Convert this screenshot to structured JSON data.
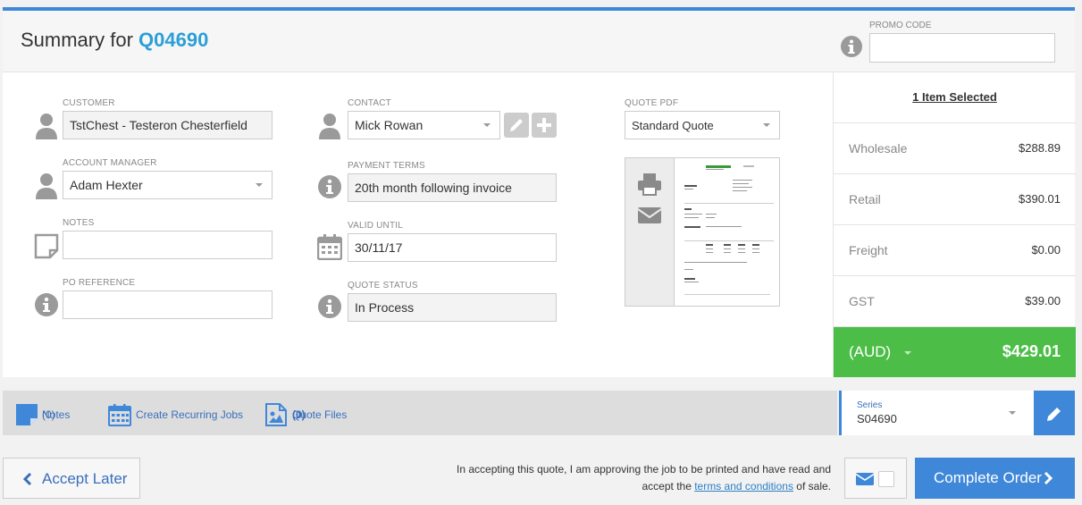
{
  "header": {
    "title_prefix": "Summary for",
    "quote_id": "Q04690",
    "promo_label": "PROMO CODE",
    "promo_value": ""
  },
  "form": {
    "customer": {
      "label": "CUSTOMER",
      "value": "TstChest - Testeron Chesterfield"
    },
    "account_manager": {
      "label": "ACCOUNT MANAGER",
      "value": "Adam Hexter"
    },
    "notes": {
      "label": "NOTES",
      "value": ""
    },
    "po_reference": {
      "label": "PO REFERENCE",
      "value": ""
    },
    "contact": {
      "label": "CONTACT",
      "value": "Mick Rowan"
    },
    "payment_terms": {
      "label": "PAYMENT TERMS",
      "value": "20th month following invoice"
    },
    "valid_until": {
      "label": "VALID UNTIL",
      "value": "30/11/17"
    },
    "quote_status": {
      "label": "QUOTE STATUS",
      "value": "In Process"
    },
    "quote_pdf": {
      "label": "QUOTE PDF",
      "value": "Standard Quote"
    }
  },
  "totals": {
    "items_selected": "1 Item Selected",
    "rows": [
      {
        "label": "Wholesale",
        "value": "$288.89"
      },
      {
        "label": "Retail",
        "value": "$390.01"
      },
      {
        "label": "Freight",
        "value": "$0.00"
      },
      {
        "label": "GST",
        "value": "$39.00"
      }
    ],
    "currency": "(AUD)",
    "grand_total": "$429.01"
  },
  "toolbar": {
    "notes": "Notes",
    "notes_count": "(0)",
    "recurring": "Create Recurring Jobs",
    "quote_files": "Quote Files",
    "quote_files_count": "(0)"
  },
  "series": {
    "label": "Series",
    "value": "S04690"
  },
  "footer": {
    "accept_later": "Accept Later",
    "terms_text_1": "In accepting this quote, I am approving the job to be printed and have read and accept the",
    "terms_link": "terms and conditions",
    "terms_text_2": "of sale.",
    "complete_order": "Complete Order"
  },
  "colors": {
    "accent": "#3f87d9",
    "total_green": "#4cbe48",
    "quote_id": "#2b9fd6"
  }
}
